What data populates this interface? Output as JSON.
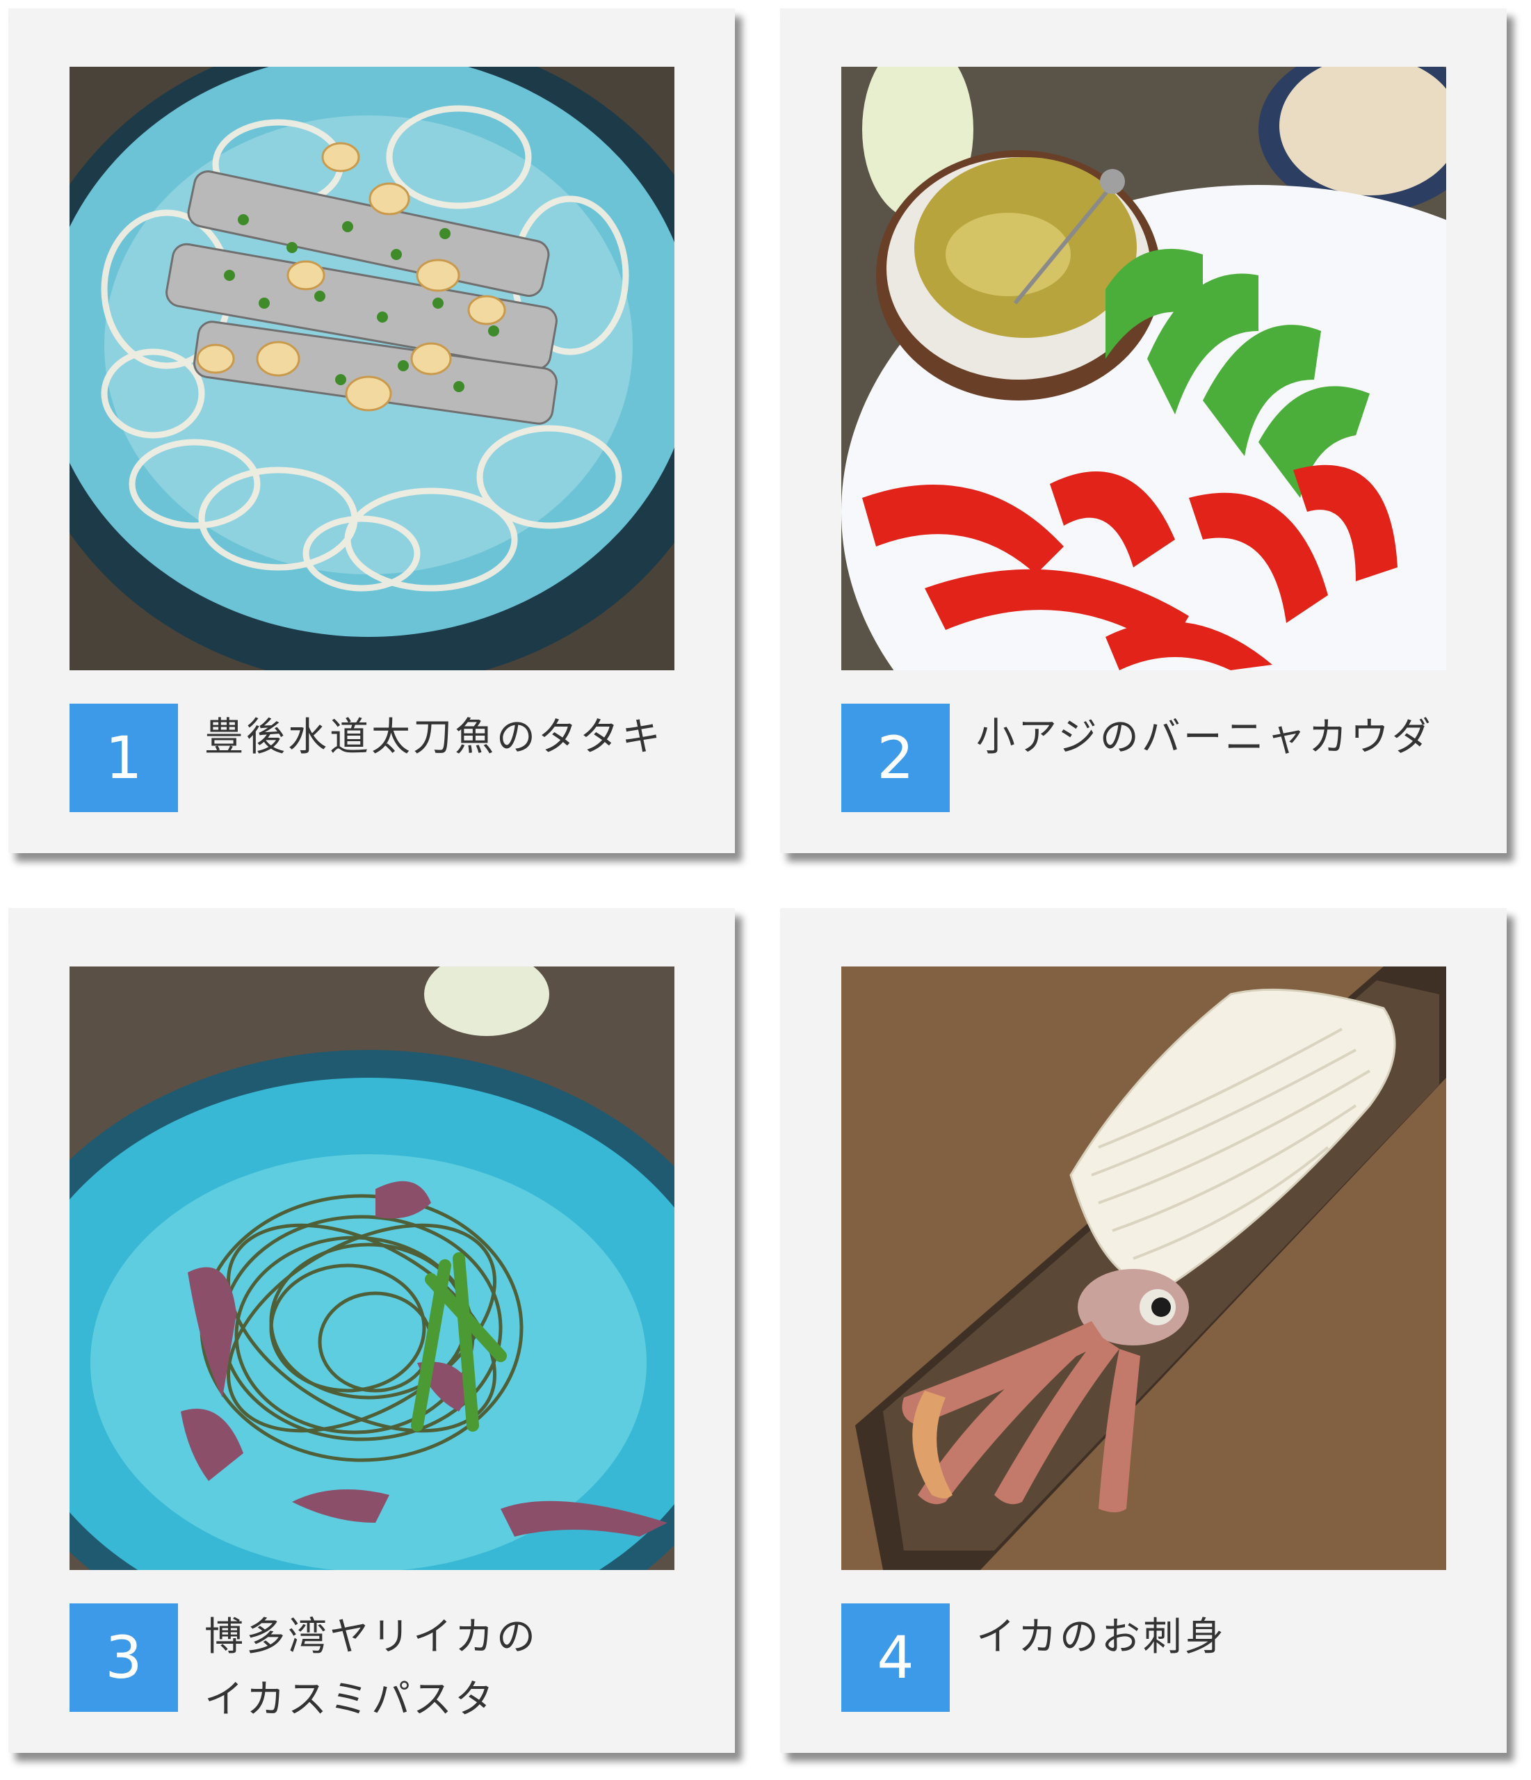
{
  "cards": [
    {
      "number": "1",
      "title_lines": [
        "豊後水道太刀魚のタタキ"
      ]
    },
    {
      "number": "2",
      "title_lines": [
        "小アジのバーニャカウダ"
      ]
    },
    {
      "number": "3",
      "title_lines": [
        "博多湾ヤリイカの",
        "イカスミパスタ"
      ]
    },
    {
      "number": "4",
      "title_lines": [
        "イカのお刺身"
      ]
    }
  ],
  "colors": {
    "badge": "#3d9ae8",
    "card_background": "#f3f3f3",
    "caption_text": "#333333"
  },
  "icons": [
    "food-photo-cutlassfish-tataki",
    "food-photo-bagna-cauda",
    "food-photo-squid-ink-pasta",
    "food-photo-squid-sashimi"
  ]
}
